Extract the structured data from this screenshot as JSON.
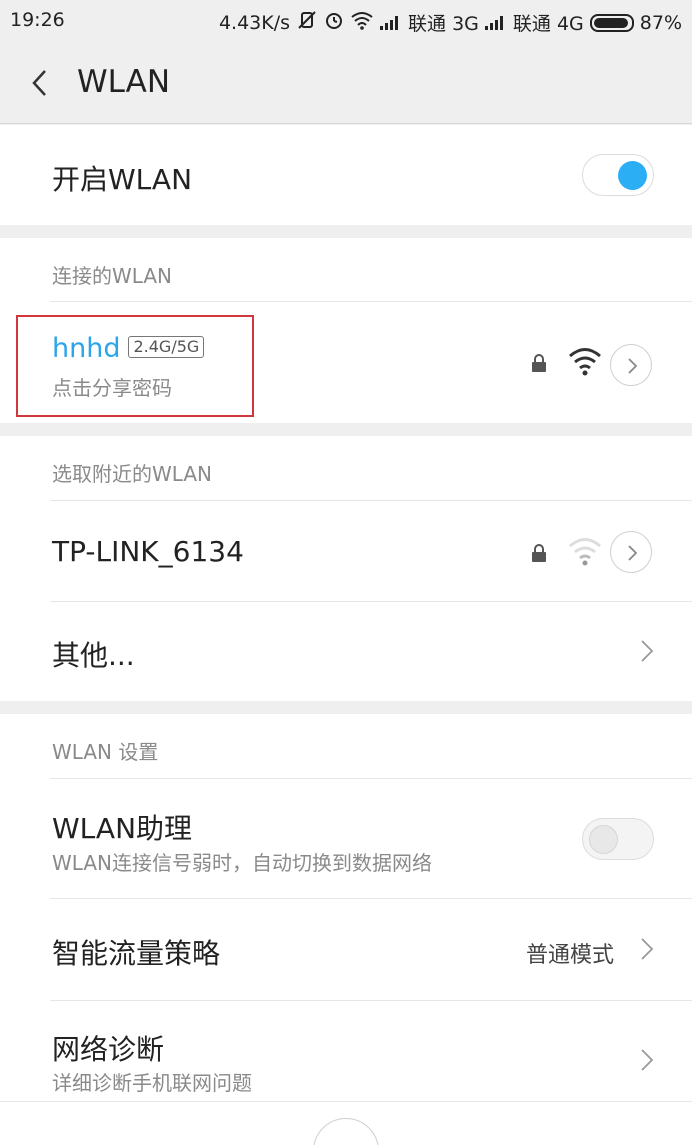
{
  "status_bar": {
    "time": "19:26",
    "net_speed": "4.43K/s",
    "carrier1": "联通 3G",
    "carrier2": "联通 4G",
    "battery": "87%"
  },
  "header": {
    "title": "WLAN"
  },
  "wlan_toggle": {
    "label": "开启WLAN",
    "state": "on"
  },
  "connected_section": {
    "header": "连接的WLAN",
    "network": {
      "name": "hnhd",
      "band": "2.4G/5G",
      "subtitle": "点击分享密码"
    }
  },
  "nearby_section": {
    "header": "选取附近的WLAN",
    "networks": [
      {
        "name": "TP-LINK_6134"
      }
    ],
    "other_label": "其他..."
  },
  "settings_section": {
    "header": "WLAN 设置",
    "assistant": {
      "label": "WLAN助理",
      "subtitle": "WLAN连接信号弱时，自动切换到数据网络",
      "state": "off"
    },
    "traffic_policy": {
      "label": "智能流量策略",
      "value": "普通模式"
    },
    "diagnose": {
      "label": "网络诊断",
      "subtitle": "详细诊断手机联网问题"
    }
  },
  "colors": {
    "accent": "#2baef3",
    "highlight_box": "#d0383b"
  }
}
